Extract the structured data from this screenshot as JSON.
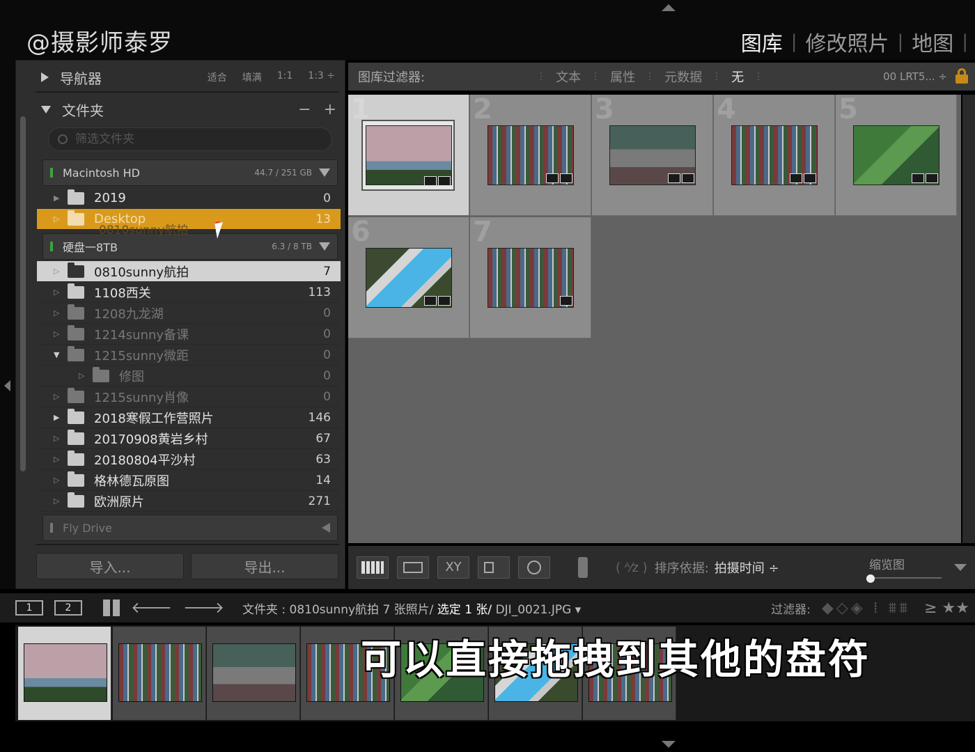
{
  "watermark": "@摄影师泰罗",
  "modules": [
    "图库",
    "修改照片",
    "地图"
  ],
  "active_module": "图库",
  "left": {
    "navigator": {
      "title": "导航器",
      "options": [
        "适合",
        "填满",
        "1:1",
        "1:3 ÷"
      ]
    },
    "folders": {
      "title": "文件夹",
      "actions": [
        "−",
        "+"
      ],
      "search_placeholder": "筛选文件夹",
      "volumes": [
        {
          "name": "Macintosh HD",
          "capacity": "44.7 / 251 GB",
          "status": "green"
        },
        {
          "name": "硬盘一8TB",
          "capacity": "6.3 / 8 TB",
          "status": "green"
        },
        {
          "name": "Fly Drive",
          "capacity": "",
          "status": "offline"
        }
      ],
      "mac_folders": [
        {
          "name": "2019",
          "count": "0"
        },
        {
          "name": "Desktop",
          "count": "13"
        }
      ],
      "drag_label": "0810sunny航拍",
      "hdd_folders": [
        {
          "name": "0810sunny航拍",
          "count": "7"
        },
        {
          "name": "1108西关",
          "count": "113"
        },
        {
          "name": "1208九龙湖",
          "count": "0"
        },
        {
          "name": "1214sunny备课",
          "count": "0"
        },
        {
          "name": "1215sunny微距",
          "count": "0"
        },
        {
          "name": "修图",
          "count": "0"
        },
        {
          "name": "1215sunny肖像",
          "count": "0"
        },
        {
          "name": "2018寒假工作营照片",
          "count": "146"
        },
        {
          "name": "20170908黄岩乡村",
          "count": "67"
        },
        {
          "name": "20180804平沙村",
          "count": "63"
        },
        {
          "name": "格林德瓦原图",
          "count": "14"
        },
        {
          "name": "欧洲原片",
          "count": "271"
        }
      ]
    },
    "import_label": "导入...",
    "export_label": "导出..."
  },
  "filter_bar": {
    "title": "图库过滤器:",
    "items": [
      "文本",
      "属性",
      "元数据",
      "无"
    ],
    "active": "无",
    "preset": "00 LRT5...  ÷"
  },
  "grid": {
    "indices": [
      "1",
      "2",
      "3",
      "4",
      "5",
      "6",
      "7"
    ],
    "selected_index": "1"
  },
  "toolbar": {
    "sort_label": "排序依据:",
    "sort_value": "拍摄时间  ÷",
    "compare_label": "XY",
    "thumb_label": "缩览图"
  },
  "filmstrip_bar": {
    "monitor1": "1",
    "monitor2": "2",
    "path_prefix": "文件夹 : 0810sunny航拍",
    "count_text": "7 张照片/",
    "selected_text": "选定 1 张/",
    "file_text": "DJI_0021.JPG ▾",
    "filter_label": "过滤器:",
    "stars": "≥ ★★"
  },
  "subtitle": "可以直接拖拽到其他的盘符"
}
